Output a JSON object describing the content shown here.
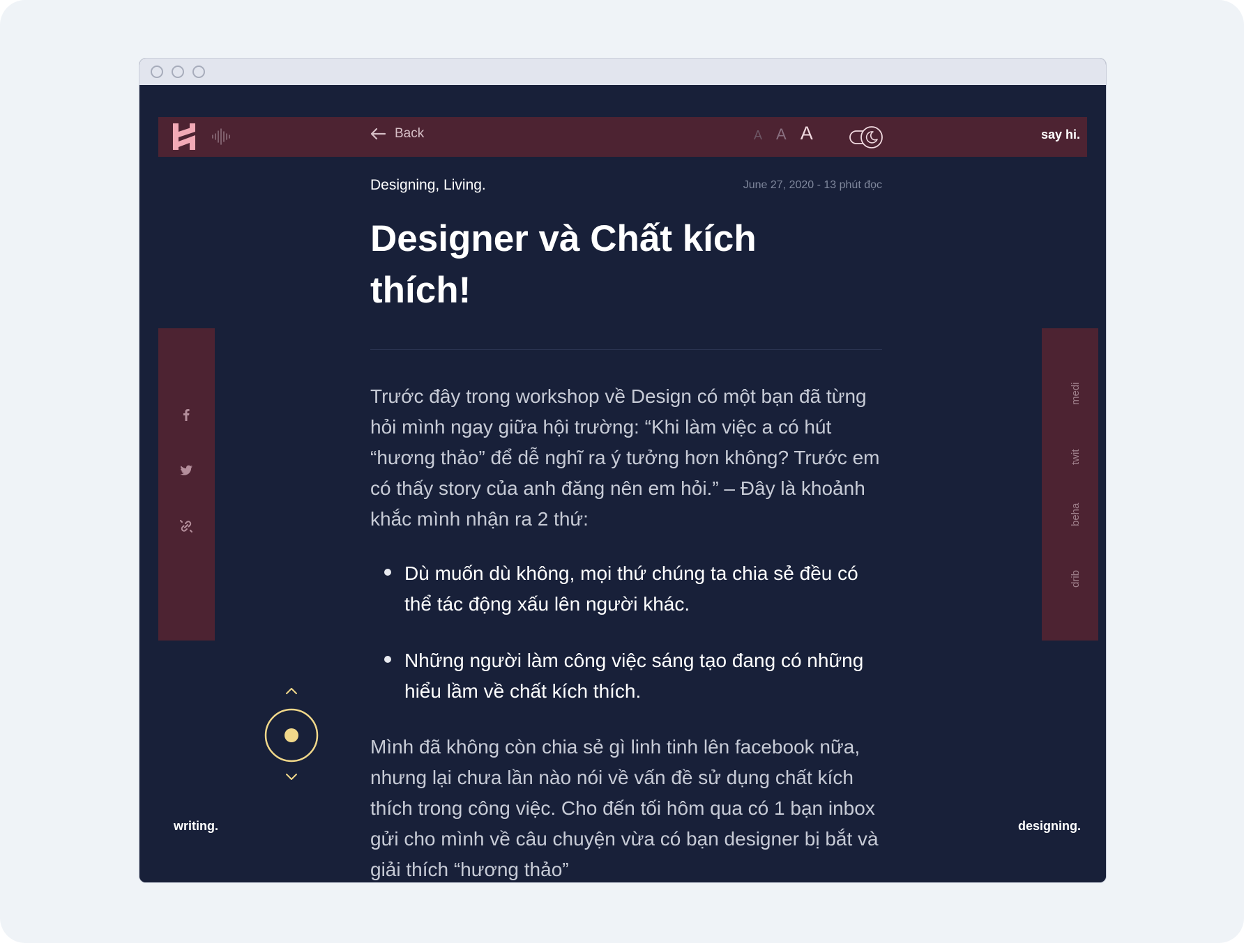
{
  "colors": {
    "page_bg": "#182039",
    "accent_panel": "#4d2332",
    "highlight_yellow": "#f1d88a",
    "outer_bg": "#eff3f7"
  },
  "nav": {
    "logo_icon": "h-logo-icon",
    "sound_icon": "sound-wave-icon",
    "back_label": "Back",
    "font_size_small": "A",
    "font_size_medium": "A",
    "font_size_large": "A",
    "theme_toggle_icon": "moon-toggle-icon",
    "say_hi": "say hi."
  },
  "article": {
    "categories": "Designing, Living.",
    "date_read": "June 27, 2020 - 13 phút đọc",
    "title": "Designer và Chất kích thích!",
    "intro": "Trước đây trong workshop về Design có một bạn đã từng hỏi mình ngay giữa hội trường: “Khi làm việc a có hút “hương thảo” để dễ nghĩ ra ý tưởng hơn không? Trước em có thấy story của anh đăng nên em hỏi.” – Đây là khoảnh khắc mình nhận ra 2 thứ:",
    "bullets": [
      "Dù muốn dù không, mọi thứ chúng ta chia sẻ đều có thể tác động xấu lên người khác.",
      "Những người làm công việc sáng tạo đang có những hiểu lầm về chất kích thích."
    ],
    "paragraph2": "Mình đã không còn chia sẻ gì linh tinh lên facebook nữa, nhưng lại chưa lần nào nói về vấn đề sử dụng chất kích thích trong công việc. Cho đến tối hôm qua có 1 bạn inbox gửi cho mình về câu chuyện vừa có bạn designer bị bắt và giải thích “hương thảo”"
  },
  "share": {
    "icons": [
      "facebook-icon",
      "twitter-icon",
      "link-icon"
    ]
  },
  "social": {
    "links": [
      "medi",
      "twit",
      "beha",
      "drib"
    ]
  },
  "footer": {
    "left": "writing.",
    "right": "designing."
  }
}
